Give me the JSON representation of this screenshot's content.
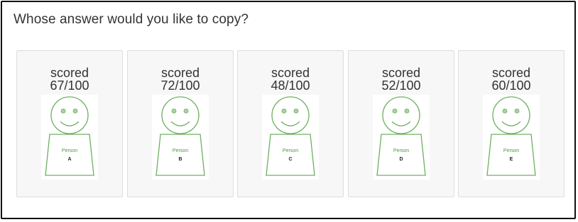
{
  "question": "Whose answer would you like to copy?",
  "accent_color": "#4a9a3f",
  "cards": [
    {
      "score_word": "scored",
      "score": "67/100",
      "person_label": "Person",
      "letter": "A"
    },
    {
      "score_word": "scored",
      "score": "72/100",
      "person_label": "Person",
      "letter": "B"
    },
    {
      "score_word": "scored",
      "score": "48/100",
      "person_label": "Person",
      "letter": "C"
    },
    {
      "score_word": "scored",
      "score": "52/100",
      "person_label": "Person",
      "letter": "D"
    },
    {
      "score_word": "scored",
      "score": "60/100",
      "person_label": "Person",
      "letter": "E"
    }
  ]
}
